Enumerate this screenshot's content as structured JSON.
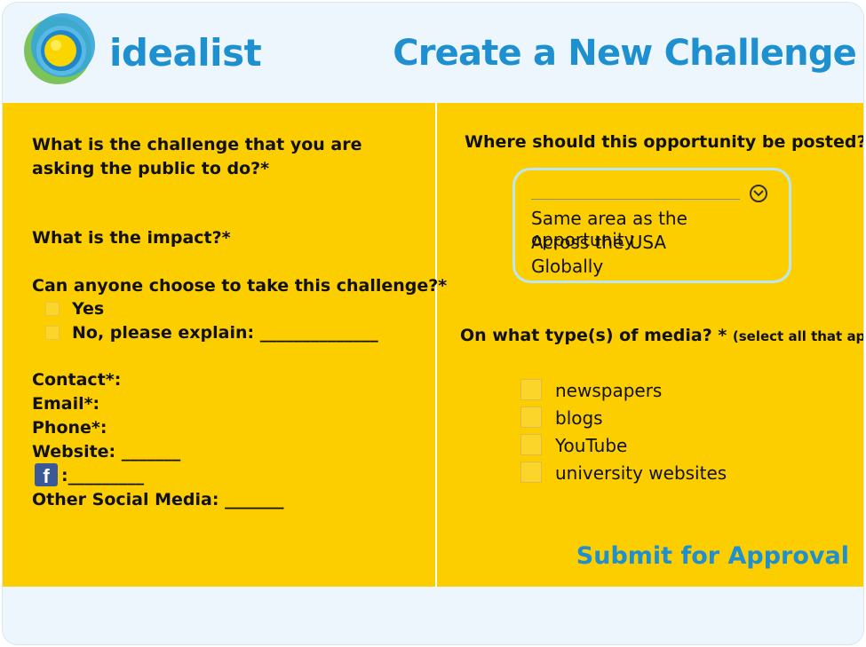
{
  "header": {
    "brand": "idealist",
    "title": "Create a New Challenge"
  },
  "left": {
    "q_challenge": "What is the challenge that you are asking the public to do?*",
    "q_impact": "What is the impact?*",
    "q_anyone": "Can anyone choose to take this challenge?*",
    "opt_yes": "Yes",
    "opt_no": "No, please explain: ______________",
    "contact": "Contact*:",
    "email": "Email*:",
    "phone": "Phone*:",
    "website": "Website: _______",
    "facebook": ":_________",
    "other_social": "Other Social Media: _______"
  },
  "right": {
    "q_posted": "Where should this opportunity be posted? *",
    "post_options": [
      "Same area as the opportunity",
      "Across the USA",
      "Globally"
    ],
    "q_media": "On what type(s) of media? *",
    "media_hint": "(select all that apply)",
    "media_options": [
      "newspapers",
      "blogs",
      "YouTube",
      "university websites"
    ]
  },
  "submit": "Submit for Approval",
  "colors": {
    "panel": "#fcce00",
    "accent": "#1e8fcf",
    "background": "#eef6fd"
  },
  "icons": {
    "logo": "idealist-sun-logo",
    "facebook": "facebook-icon",
    "dropdown": "chevron-down-circle-icon"
  }
}
